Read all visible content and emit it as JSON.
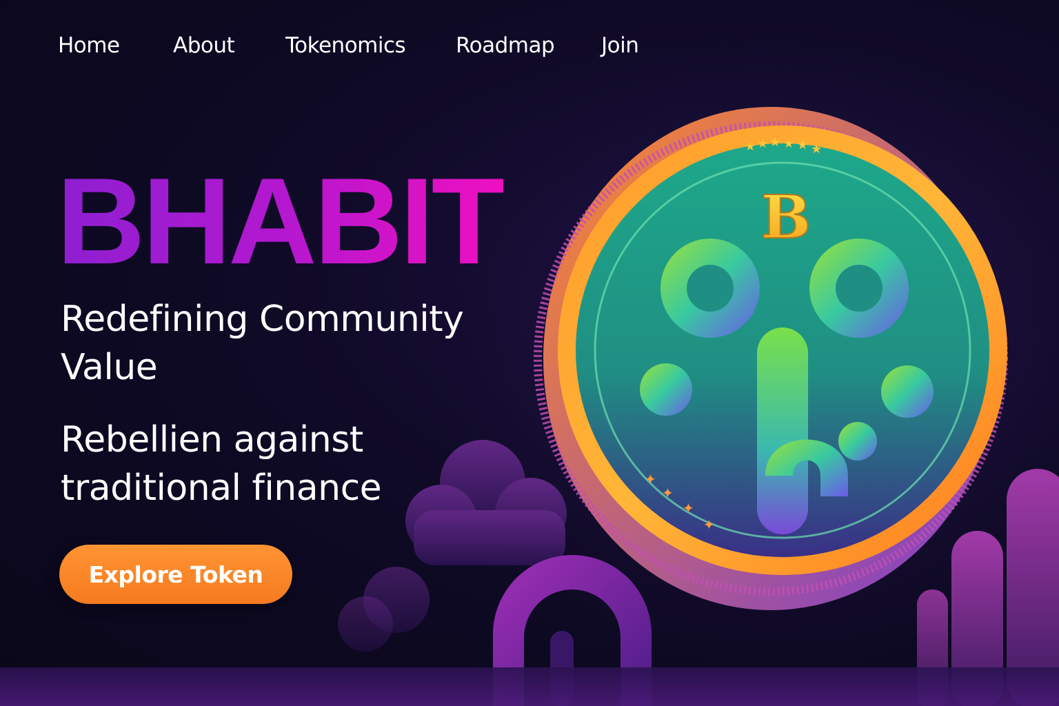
{
  "nav": {
    "items": [
      {
        "label": "Home"
      },
      {
        "label": "About"
      },
      {
        "label": "Tokenomics"
      },
      {
        "label": "Roadmap"
      },
      {
        "label": "Join"
      }
    ]
  },
  "hero": {
    "brand": "BHABIT",
    "tagline": "Redefining Community Value",
    "subline": "Rebellien against traditional finance",
    "cta_label": "Explore Token"
  },
  "coin": {
    "letter": "B"
  },
  "colors": {
    "background": "#0f0a26",
    "brand_start": "#8e1fd1",
    "brand_end": "#ee10c0",
    "cta": "#f7821f",
    "coin_face": "#1f9a86",
    "coin_rim": "#ff8a1e"
  }
}
